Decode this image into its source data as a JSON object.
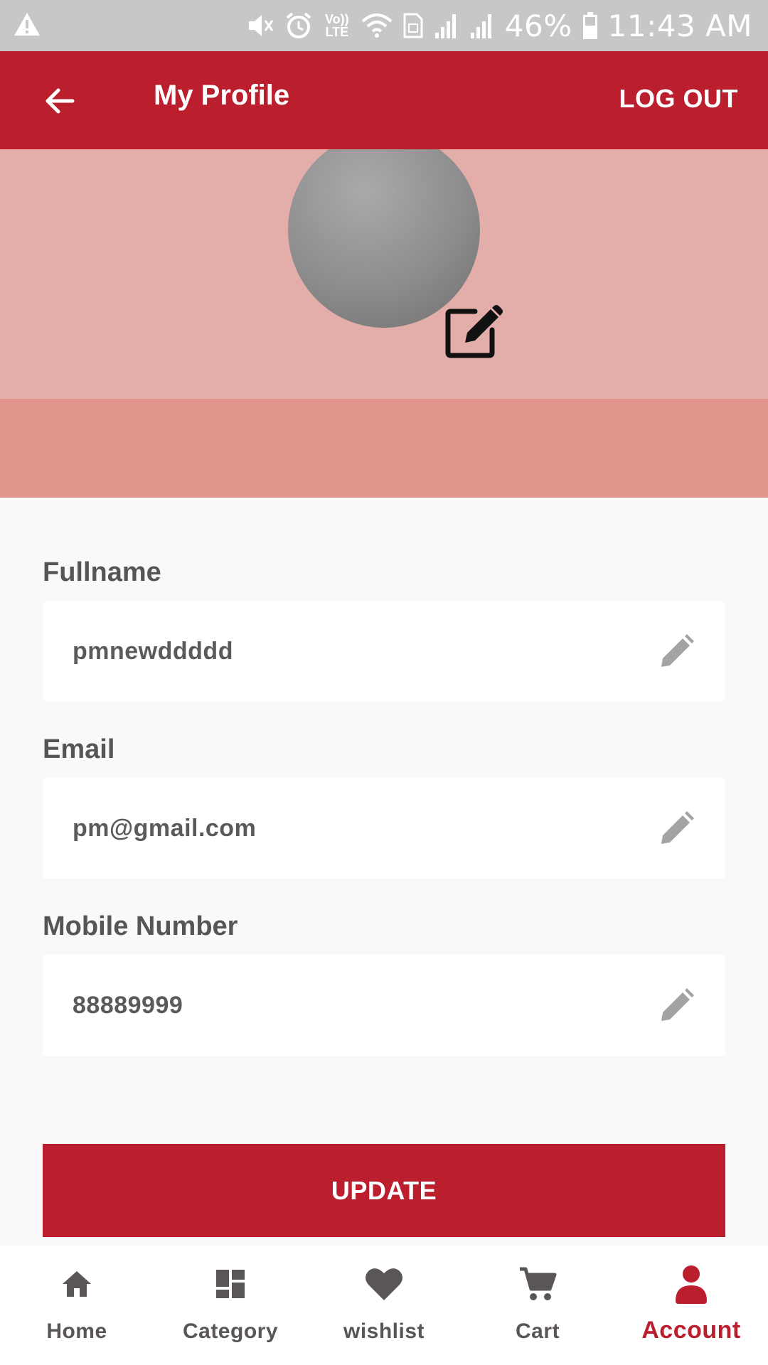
{
  "status_bar": {
    "battery": "46%",
    "time": "11:43 AM",
    "volte": "Vo)) LTE",
    "icons": [
      "warning-icon",
      "mute-icon",
      "alarm-icon",
      "volte-icon",
      "wifi-icon",
      "sim-icon",
      "signal-icon",
      "signal-icon",
      "battery-icon"
    ]
  },
  "app_bar": {
    "title": "My Profile",
    "logout_label": "LOG OUT",
    "back_icon": "arrow-left-icon"
  },
  "profile": {
    "avatar_edit_icon": "edit-square-icon"
  },
  "form": {
    "fields": [
      {
        "label": "Fullname",
        "value": "pmnewddddd",
        "icon": "pencil-icon"
      },
      {
        "label": "Email",
        "value": "pm@gmail.com",
        "icon": "pencil-icon"
      },
      {
        "label": "Mobile Number",
        "value": "88889999",
        "icon": "pencil-icon"
      }
    ],
    "update_label": "UPDATE"
  },
  "bottom_nav": {
    "items": [
      {
        "label": "Home",
        "icon": "home-icon",
        "active": false
      },
      {
        "label": "Category",
        "icon": "dashboard-icon",
        "active": false
      },
      {
        "label": "wishlist",
        "icon": "heart-icon",
        "active": false
      },
      {
        "label": "Cart",
        "icon": "cart-icon",
        "active": false
      },
      {
        "label": "Account",
        "icon": "person-icon",
        "active": true
      }
    ]
  },
  "colors": {
    "brand_red": "#bb1e2d",
    "hero_light": "#e3adaa",
    "hero_dark": "#e2958c",
    "nav_inactive": "#5a5556",
    "background": "#f9f9f9"
  }
}
